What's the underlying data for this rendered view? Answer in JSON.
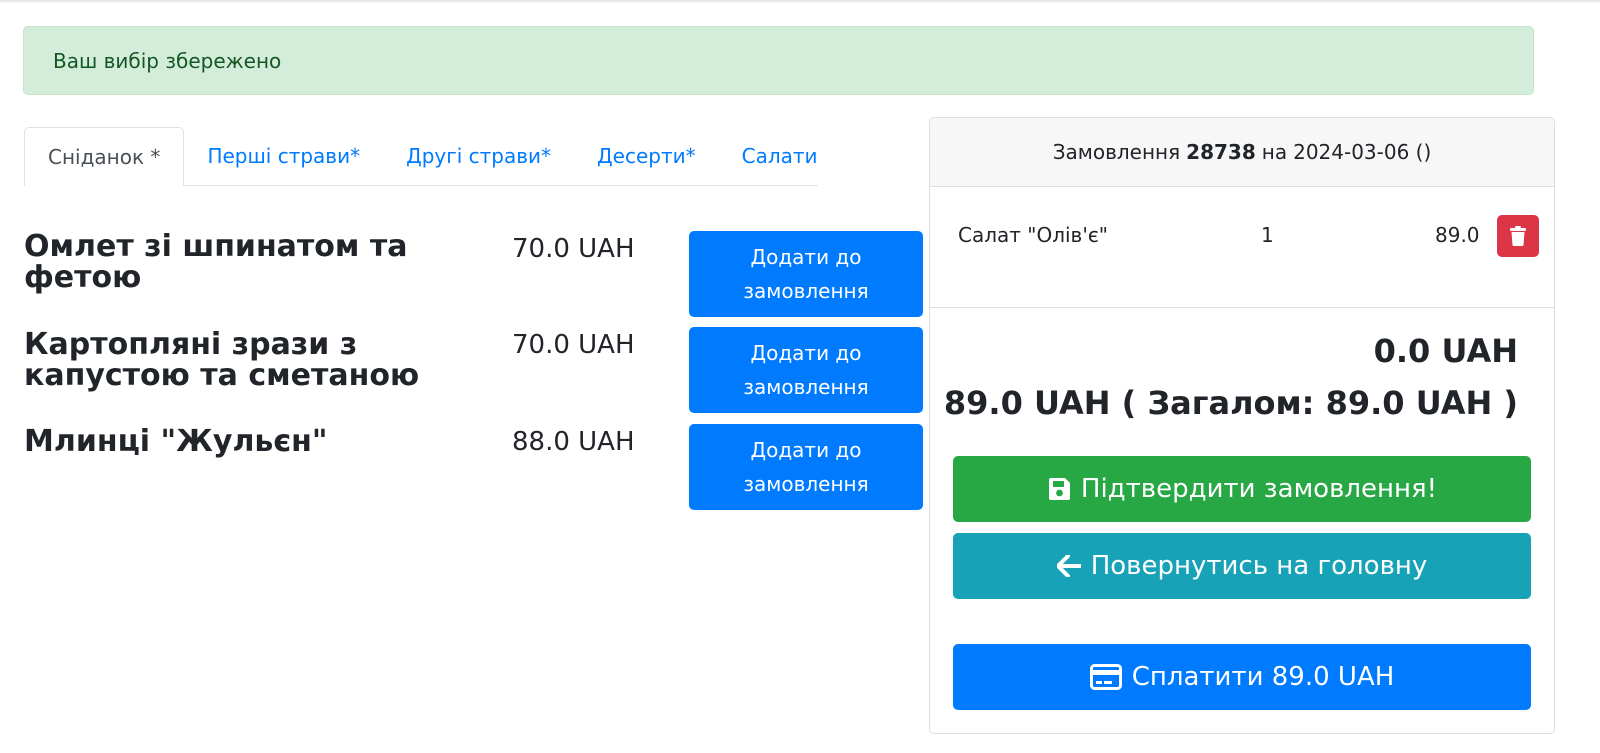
{
  "alert": {
    "text": "Ваш вибір збережено"
  },
  "tabs": [
    {
      "label": "Сніданок *",
      "active": true
    },
    {
      "label": "Перші страви*",
      "active": false
    },
    {
      "label": "Другі страви*",
      "active": false
    },
    {
      "label": "Десерти*",
      "active": false
    },
    {
      "label": "Салати",
      "active": false
    }
  ],
  "menu": {
    "items": [
      {
        "name": "Омлет зі шпинатом та фетою",
        "price": "70.0 UAH",
        "button": "Додати до замовлення"
      },
      {
        "name": "Картопляні зрази з капустою та сметаною",
        "price": "70.0 UAH",
        "button": "Додати до замовлення"
      },
      {
        "name": "Млинці \"Жульєн\"",
        "price": "88.0 UAH",
        "button": "Додати до замовлення"
      }
    ]
  },
  "order": {
    "header_prefix": "Замовлення",
    "number": "28738",
    "header_mid": "на",
    "date": "2024-03-06 ()",
    "rows": [
      {
        "name": "Салат \"Олів'є\"",
        "qty": "1",
        "sum": "89.0",
        "delete_icon": "trash-icon"
      }
    ],
    "paid_total": "0.0 UAH",
    "total_line": "89.0 UAH ( Загалом: 89.0 UAH )",
    "confirm_label": "Підтвердити замовлення!",
    "confirm_icon": "save-icon",
    "back_label": "Повернутись на головну",
    "back_icon": "arrow-left-icon",
    "pay_label": "Сплатити 89.0 UAH",
    "pay_icon": "credit-card-icon"
  },
  "colors": {
    "primary": "#007bff",
    "success": "#28a745",
    "info": "#17a2b8",
    "danger": "#dc3545",
    "alert_bg": "#d4edda",
    "alert_text": "#155724"
  }
}
